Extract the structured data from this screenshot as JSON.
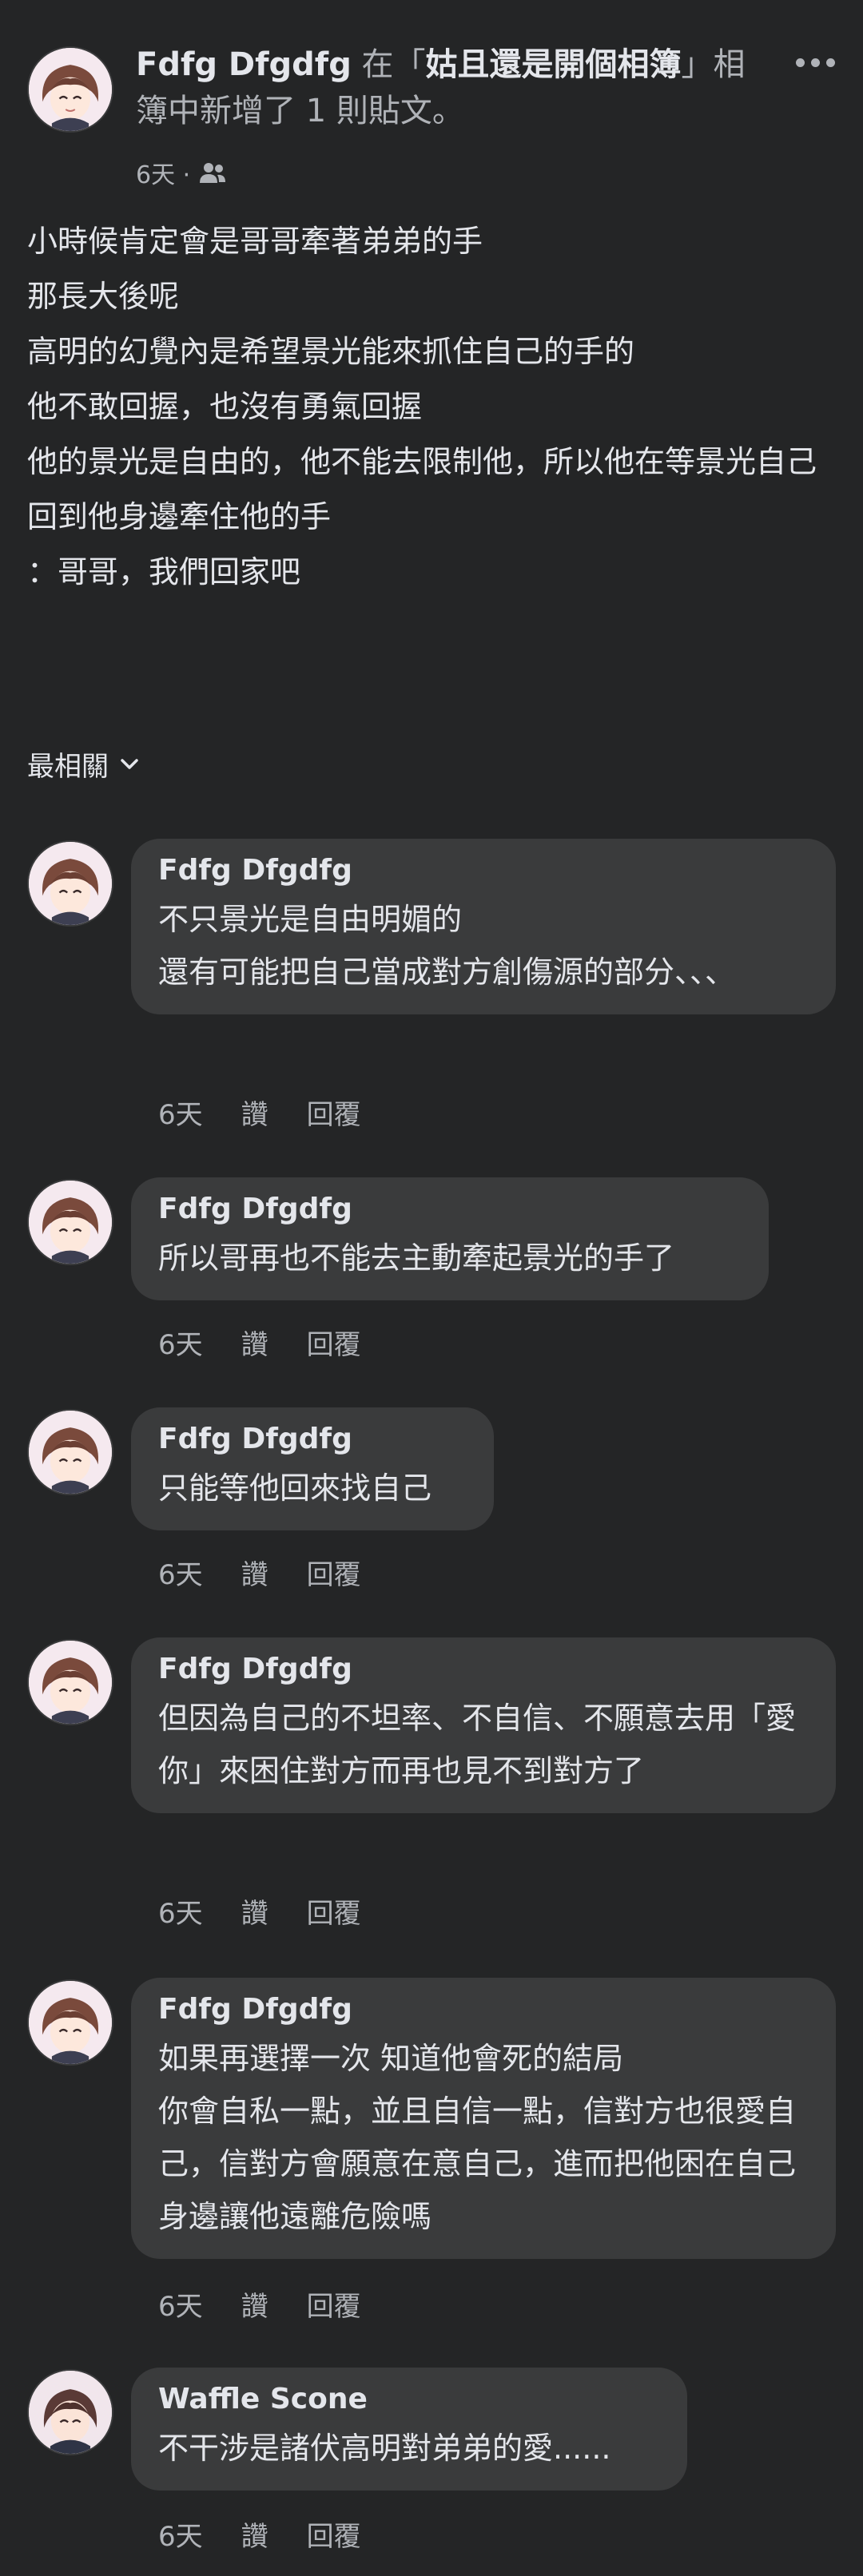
{
  "post": {
    "author": "Fdfg Dfgdfg",
    "connector": " 在「",
    "group": "姑且還是開個相簿",
    "suffix": "」相簿中新增了 1 則貼文。",
    "time": "6天 · ",
    "audience_icon": "friends-icon",
    "lines": [
      "小時候肯定會是哥哥牽著弟弟的手",
      "那長大後呢",
      "高明的幻覺內是希望景光能來抓住自己的手的",
      "他不敢回握，也沒有勇氣回握",
      "他的景光是自由的，他不能去限制他，所以他在等景光自己回到他身邊牽住他的手",
      "：哥哥，我們回家吧"
    ]
  },
  "sort": {
    "label": "最相關"
  },
  "comments": [
    {
      "name": "Fdfg Dfgdfg",
      "text": "不只景光是自由明媚的\n還有可能把自己當成對方創傷源的部分、、、",
      "time": "6天",
      "like": "讚",
      "reply": "回覆"
    },
    {
      "name": "Fdfg Dfgdfg",
      "text": "所以哥再也不能去主動牽起景光的手了",
      "time": "6天",
      "like": "讚",
      "reply": "回覆"
    },
    {
      "name": "Fdfg Dfgdfg",
      "text": "只能等他回來找自己",
      "time": "6天",
      "like": "讚",
      "reply": "回覆"
    },
    {
      "name": "Fdfg Dfgdfg",
      "text": "但因為自己的不坦率、不自信、不願意去用「愛你」來困住對方而再也見不到對方了",
      "time": "6天",
      "like": "讚",
      "reply": "回覆"
    },
    {
      "name": "Fdfg Dfgdfg",
      "text": "如果再選擇一次 知道他會死的結局\n你會自私一點，並且自信一點，信對方也很愛自己，信對方會願意在意自己，進而把他困在自己身邊讓他遠離危險嗎",
      "time": "6天",
      "like": "讚",
      "reply": "回覆"
    },
    {
      "name": "Waffle Scone",
      "text": "不干涉是諸伏高明對弟弟的愛......",
      "time": "6天",
      "like": "讚",
      "reply": "回覆"
    }
  ]
}
